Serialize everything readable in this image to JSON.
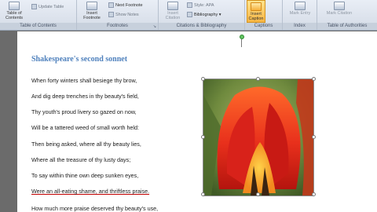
{
  "ribbon": {
    "toc": {
      "label": "Table of Contents",
      "update": "Update Table",
      "group": "Table of Contents"
    },
    "footnotes": {
      "insert": "Insert Footnote",
      "next": "Next Footnote",
      "show": "Show Notes",
      "group": "Footnotes"
    },
    "citations": {
      "insert": "Insert Citation",
      "style_label": "Style:",
      "style_value": "APA",
      "bibliography": "Bibliography",
      "group": "Citations & Bibliography"
    },
    "captions": {
      "insert": "Insert Caption",
      "group": "Captions"
    },
    "index": {
      "mark": "Mark Entry",
      "group": "Index"
    },
    "authorities": {
      "mark": "Mark Citation",
      "group": "Table of Authorities"
    }
  },
  "document": {
    "title": "Shakespeare's second sonnet",
    "lines": [
      "When forty winters shall besiege thy brow,",
      "And dig deep trenches in thy beauty's field,",
      "Thy youth's proud livery so gazed on now,",
      "Will be a tattered weed of small worth held:",
      "Then being asked, where all thy beauty lies,",
      "Where all the treasure of thy lusty days;",
      "To say within thine own deep sunken eyes,",
      "Were an all-eating shame, and thriftless praise.",
      "How much more praise deserved thy beauty's use,"
    ]
  },
  "image": {
    "subject": "red tulip photo"
  }
}
